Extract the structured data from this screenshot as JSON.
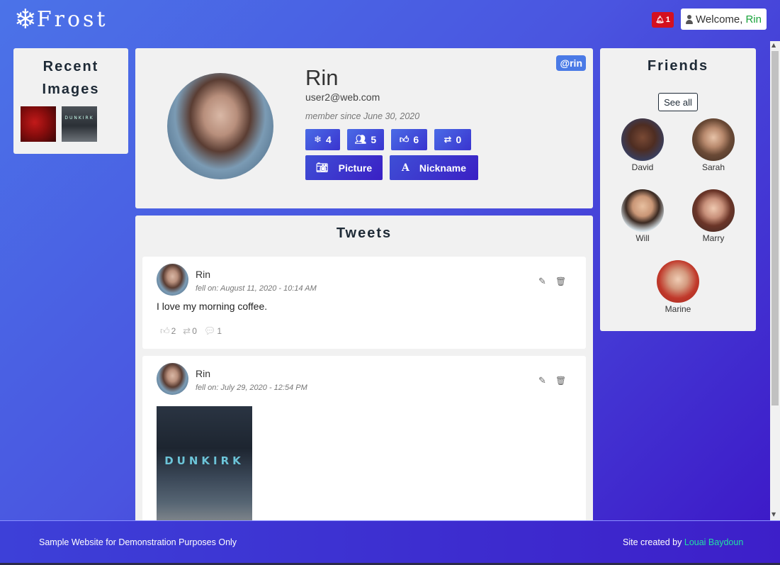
{
  "header": {
    "logo_text": "Frost",
    "notification_count": "1",
    "welcome_prefix": "Welcome,",
    "welcome_user": "Rin"
  },
  "recent_images": {
    "title": "Recent Images",
    "thumb2_text": "DUNKIRK"
  },
  "profile": {
    "name": "Rin",
    "handle": "@rin",
    "email": "user2@web.com",
    "member_since": "member since June 30, 2020",
    "stats": [
      {
        "icon": "snowflake-icon",
        "value": "4"
      },
      {
        "icon": "users-icon",
        "value": "5"
      },
      {
        "icon": "thumbs-up-icon",
        "value": "6"
      },
      {
        "icon": "retweet-icon",
        "value": "0"
      }
    ],
    "actions": {
      "picture": "Picture",
      "nickname": "Nickname"
    }
  },
  "tweets": {
    "title": "Tweets",
    "items": [
      {
        "author": "Rin",
        "date": "fell on: August 11, 2020 - 10:14 AM",
        "text": "I love my morning coffee.",
        "likes": "2",
        "retweets": "0",
        "comments": "1"
      },
      {
        "author": "Rin",
        "date": "fell on: July 29, 2020 - 12:54 PM",
        "image_text": "DUNKIRK"
      }
    ]
  },
  "friends": {
    "title": "Friends",
    "see_all": "See all",
    "list": [
      {
        "name": "David"
      },
      {
        "name": "Sarah"
      },
      {
        "name": "Will"
      },
      {
        "name": "Marry"
      },
      {
        "name": "Marine"
      }
    ]
  },
  "footer": {
    "left": "Sample Website for Demonstration Purposes Only",
    "right_prefix": "Site created by",
    "author": "Louai Baydoun"
  },
  "colors": {
    "accent": "#4a6be6",
    "notification": "#d4101f",
    "welcome_name": "#18a33a",
    "footer_link": "#22e0a3"
  }
}
